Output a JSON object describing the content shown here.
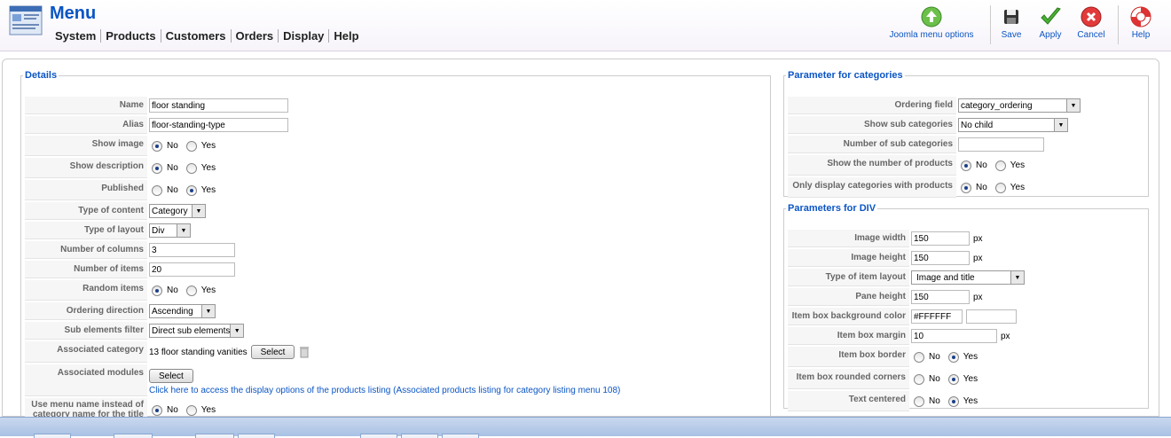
{
  "header": {
    "title": "Menu",
    "menu": [
      "System",
      "Products",
      "Customers",
      "Orders",
      "Display",
      "Help"
    ]
  },
  "toolbar": {
    "menu_options_label": "Joomla menu options",
    "save_label": "Save",
    "apply_label": "Apply",
    "cancel_label": "Cancel",
    "help_label": "Help"
  },
  "details": {
    "legend": "Details",
    "name_label": "Name",
    "name_value": "floor standing",
    "alias_label": "Alias",
    "alias_value": "floor-standing-type",
    "show_image_label": "Show image",
    "show_description_label": "Show description",
    "published_label": "Published",
    "type_of_content_label": "Type of content",
    "type_of_content_value": "Category",
    "type_of_layout_label": "Type of layout",
    "type_of_layout_value": "Div",
    "number_of_columns_label": "Number of columns",
    "number_of_columns_value": "3",
    "number_of_items_label": "Number of items",
    "number_of_items_value": "20",
    "random_items_label": "Random items",
    "ordering_direction_label": "Ordering direction",
    "ordering_direction_value": "Ascending",
    "sub_elements_filter_label": "Sub elements filter",
    "sub_elements_filter_value": "Direct sub elements",
    "associated_category_label": "Associated category",
    "associated_category_value": "13 floor standing vanities",
    "associated_modules_label": "Associated modules",
    "associated_modules_link": "Click here to access the display options of the products listing (Associated products listing for category listing menu 108)",
    "use_menu_name_label": "Use menu name instead of category name for the title",
    "select_label": "Select",
    "no_label": "No",
    "yes_label": "Yes"
  },
  "categories": {
    "legend": "Parameter for categories",
    "ordering_field_label": "Ordering field",
    "ordering_field_value": "category_ordering",
    "show_sub_categories_label": "Show sub categories",
    "show_sub_categories_value": "No child",
    "number_of_sub_categories_label": "Number of sub categories",
    "number_of_sub_categories_value": "",
    "show_number_of_products_label": "Show the number of products",
    "only_display_label": "Only display categories with products"
  },
  "div_params": {
    "legend": "Parameters for DIV",
    "image_width_label": "Image width",
    "image_width_value": "150",
    "image_height_label": "Image height",
    "image_height_value": "150",
    "type_of_item_layout_label": "Type of item layout",
    "type_of_item_layout_value": "Image and title",
    "pane_height_label": "Pane height",
    "pane_height_value": "150",
    "item_box_bg_label": "Item box background color",
    "item_box_bg_value": "#FFFFFF",
    "item_box_margin_label": "Item box margin",
    "item_box_margin_value": "10",
    "item_box_border_label": "Item box border",
    "item_box_rounded_label": "Item box rounded corners",
    "text_centered_label": "Text centered",
    "px_unit": "px"
  },
  "colors": {
    "accent": "#0b55c4",
    "label_bg": "#f6f6f6",
    "taskbar": "#a9c1e4"
  }
}
